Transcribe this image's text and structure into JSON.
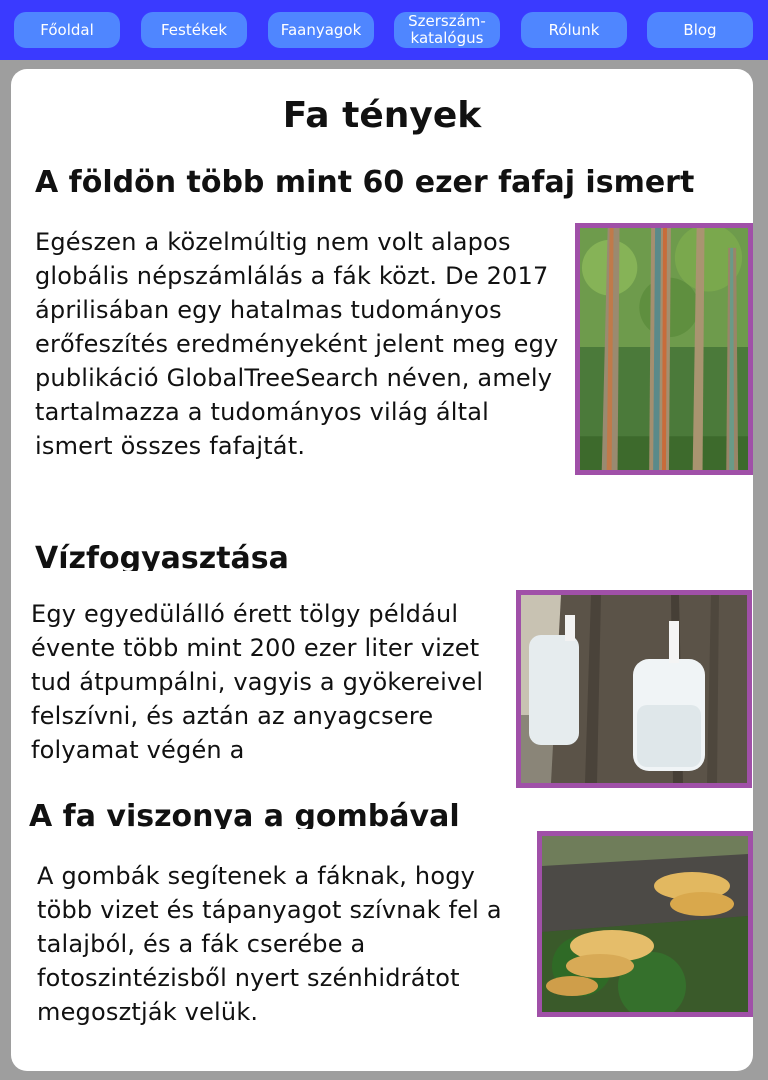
{
  "nav": {
    "items": [
      {
        "label": "Főoldal"
      },
      {
        "label": "Festékek"
      },
      {
        "label": "Faanyagok"
      },
      {
        "label": "Szerszám-\nkatalógus"
      },
      {
        "label": "Rólunk"
      },
      {
        "label": "Blog"
      }
    ]
  },
  "page": {
    "title": "Fa tények"
  },
  "sections": [
    {
      "heading": "A földön több mint 60 ezer fafaj ismert",
      "text": "Egészen a közelmúltig nem volt alapos globális népszámlálás a fák közt. De 2017 áprilisában egy hatalmas tudományos erőfeszítés eredményeként jelent meg egy publikáció GlobalTreeSearch néven, amely tartalmazza a tudományos világ által ismert összes fafajtát."
    },
    {
      "heading": "Vízfogyasztása",
      "text": "Egy egyedülálló érett tölgy például évente több mint 200 ezer liter vizet tud átpumpálni, vagyis a gyökereivel felszívni, és aztán az anyagcsere folyamat végén a"
    },
    {
      "heading": "A fa viszonya a gombával",
      "text": "A gombák segítenek a fáknak, hogy több vizet és tápanyagot szívnak fel a talajból, és a fák cserébe a fotoszintézisből nyert szénhidrátot megosztják velük."
    }
  ]
}
